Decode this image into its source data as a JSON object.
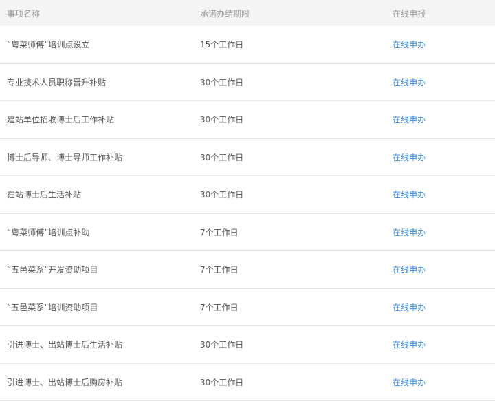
{
  "columns": {
    "item": "事项名称",
    "deadline": "承诺办结期限",
    "apply": "在线申报"
  },
  "rows": [
    {
      "item": "“粤菜师傅”培训点设立",
      "deadline": "15个工作日",
      "apply": "在线申办"
    },
    {
      "item": "专业技术人员职称晋升补贴",
      "deadline": "30个工作日",
      "apply": "在线申办"
    },
    {
      "item": "建站单位招收博士后工作补贴",
      "deadline": "30个工作日",
      "apply": "在线申办"
    },
    {
      "item": "博士后导师、博士导师工作补贴",
      "deadline": "30个工作日",
      "apply": "在线申办"
    },
    {
      "item": "在站博士后生活补贴",
      "deadline": "30个工作日",
      "apply": "在线申办"
    },
    {
      "item": "“粤菜师傅”培训点补助",
      "deadline": "7个工作日",
      "apply": "在线申办"
    },
    {
      "item": "“五邑菜系”开发资助项目",
      "deadline": "7个工作日",
      "apply": "在线申办"
    },
    {
      "item": "“五邑菜系”培训资助项目",
      "deadline": "7个工作日",
      "apply": "在线申办"
    },
    {
      "item": "引进博士、出站博士后生活补贴",
      "deadline": "30个工作日",
      "apply": "在线申办"
    },
    {
      "item": "引进博士、出站博士后购房补贴",
      "deadline": "30个工作日",
      "apply": "在线申办"
    }
  ],
  "colors": {
    "header_bg": "#f4f4f4",
    "link": "#3a8ee6",
    "text": "#555555",
    "header_text": "#999999"
  }
}
